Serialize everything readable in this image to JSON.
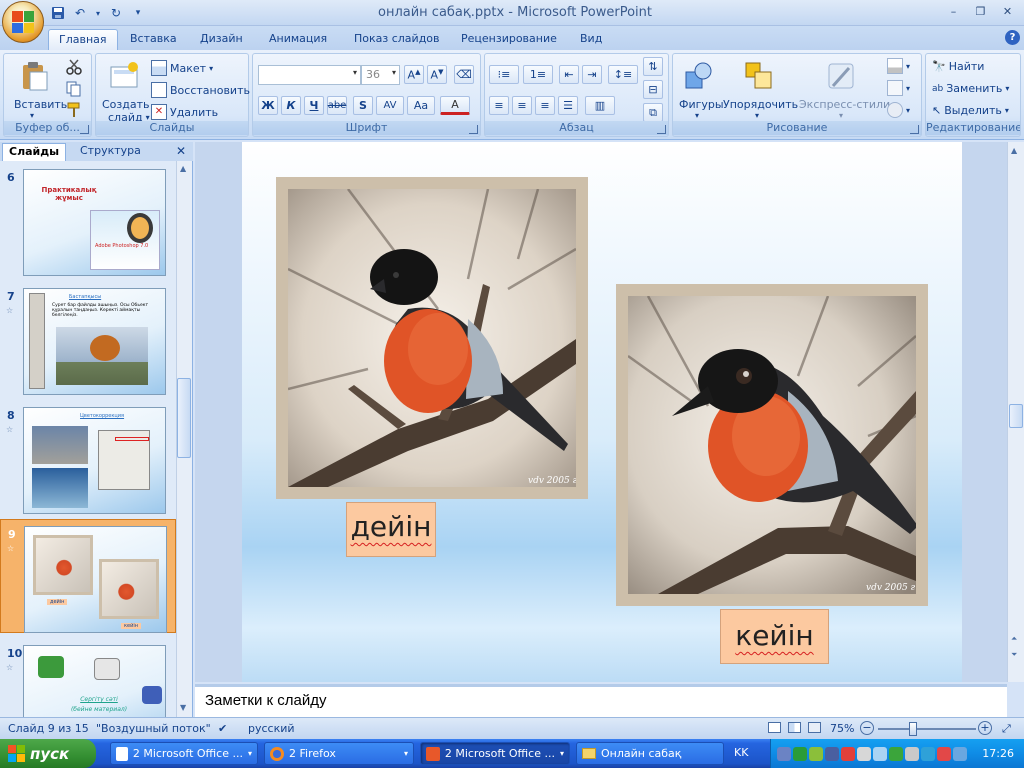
{
  "window": {
    "title": "онлайн сабақ.pptx - Microsoft PowerPoint",
    "controls": [
      "–",
      "❐",
      "✕"
    ]
  },
  "ribbon_tabs": [
    "Главная",
    "Вставка",
    "Дизайн",
    "Анимация",
    "Показ слайдов",
    "Рецензирование",
    "Вид"
  ],
  "active_tab": "Главная",
  "ribbon": {
    "clipboard": {
      "label": "Буфер об...",
      "paste": "Вставить"
    },
    "slides": {
      "label": "Слайды",
      "new_slide": "Создать",
      "new_slide2": "слайд",
      "layout": "Макет",
      "reset": "Восстановить",
      "delete": "Удалить"
    },
    "font": {
      "label": "Шрифт",
      "font_name": "",
      "font_size": "36",
      "bold": "Ж",
      "italic": "К",
      "underline": "Ч",
      "strike": "abe",
      "shadow": "S",
      "spacing": "AV",
      "case": "Aa",
      "color": "A"
    },
    "paragraph": {
      "label": "Абзац"
    },
    "drawing": {
      "label": "Рисование",
      "shapes": "Фигуры",
      "arrange": "Упорядочить",
      "quick_styles": "Экспресс-стили"
    },
    "editing": {
      "label": "Редактирование",
      "find": "Найти",
      "replace": "Заменить",
      "select": "Выделить"
    }
  },
  "left_pane": {
    "tabs": [
      "Слайды",
      "Структура"
    ],
    "slides": [
      {
        "num": "6",
        "title": "Практикалық жұмыс",
        "caption": "Adobe Photoshop 7.0"
      },
      {
        "num": "7",
        "title": "Бастапқысы",
        "text": "Сурет бар файлды ашыңыз. Осы Обьект құралын таңдаңыз. Керекті аймақты белгілеңіз."
      },
      {
        "num": "8",
        "title": "Цветокоррекция"
      },
      {
        "num": "9",
        "before": "дейін",
        "after": "кейін"
      },
      {
        "num": "10",
        "title": "Сергіту сәті",
        "subtitle": "(бейне материал)"
      }
    ],
    "selected": "9"
  },
  "slide": {
    "before_label": "дейін",
    "after_label": "кейін",
    "watermark1": "vdv  2005 г.",
    "watermark2": "vdv  2005 г."
  },
  "notes": {
    "placeholder": "Заметки к слайду"
  },
  "status": {
    "slide_info": "Слайд 9 из 15",
    "theme": "\"Воздушный поток\"",
    "language": "русский",
    "zoom": "75%"
  },
  "taskbar": {
    "start": "пуск",
    "tasks": [
      "2 Microsoft Office ...",
      "2 Firefox",
      "2 Microsoft Office ...",
      "Онлайн сабақ"
    ],
    "lang": "KK",
    "clock": "17:26"
  }
}
